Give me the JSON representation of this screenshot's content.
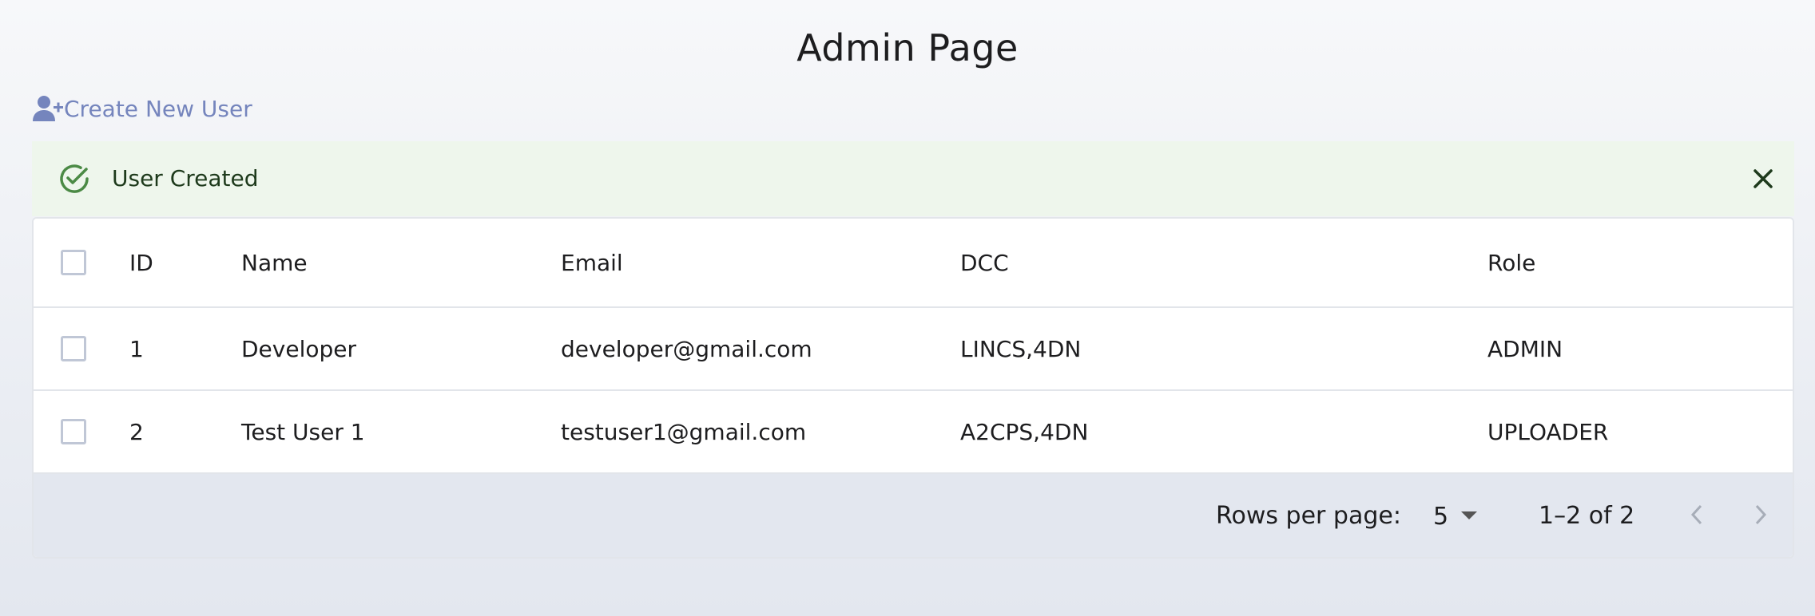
{
  "page": {
    "title": "Admin Page"
  },
  "create_user": {
    "label": "Create New User",
    "icon": "person-add-icon",
    "color": "#7585bd"
  },
  "alert": {
    "text": "User Created",
    "icon": "check-circle-icon",
    "close_icon": "close-icon",
    "background": "#eef6ec",
    "accent": "#4b8a45"
  },
  "table": {
    "columns": [
      "ID",
      "Name",
      "Email",
      "DCC",
      "Role"
    ],
    "rows": [
      {
        "id": "1",
        "name": "Developer",
        "email": "developer@gmail.com",
        "dcc": "LINCS,4DN",
        "role": "ADMIN"
      },
      {
        "id": "2",
        "name": "Test User 1",
        "email": "testuser1@gmail.com",
        "dcc": "A2CPS,4DN",
        "role": "UPLOADER"
      }
    ]
  },
  "pagination": {
    "rows_per_page_label": "Rows per page:",
    "rows_per_page_value": "5",
    "range_text": "1–2 of 2"
  }
}
